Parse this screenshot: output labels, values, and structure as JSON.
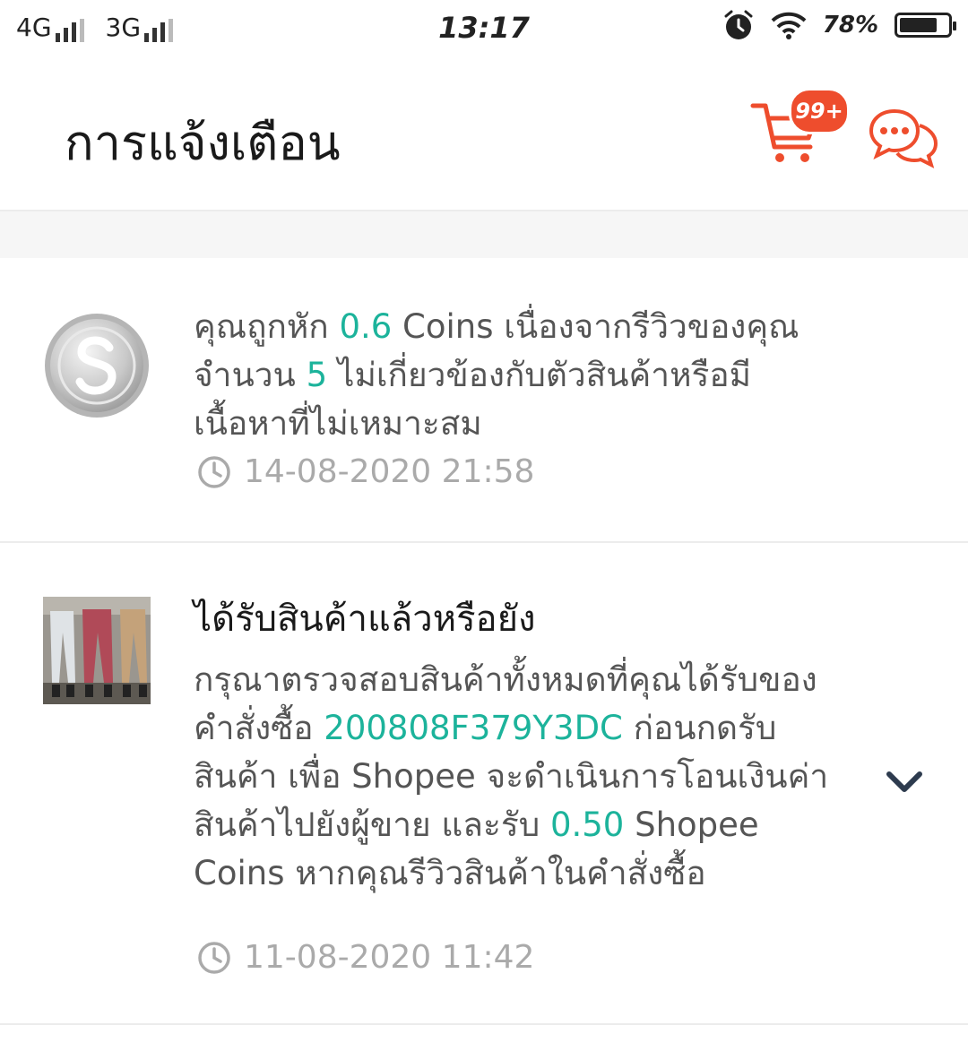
{
  "status_bar": {
    "network1": "4G",
    "network2": "3G",
    "time": "13:17",
    "battery_percent": "78%",
    "battery_level": 0.78
  },
  "header": {
    "title": "การแจ้งเตือน",
    "cart_badge": "99+"
  },
  "colors": {
    "accent": "#ee4d2d",
    "highlight": "#1cb39b",
    "muted": "#aaaaaa"
  },
  "notifications": [
    {
      "icon": "shopee-coin-icon",
      "message_parts": [
        {
          "text": "คุณถูกหัก ",
          "hl": false
        },
        {
          "text": "0.6",
          "hl": true
        },
        {
          "text": " Coins เนื่องจากรีวิวของคุณจำนวน ",
          "hl": false
        },
        {
          "text": "5",
          "hl": true
        },
        {
          "text": " ไม่เกี่ยวข้องกับตัวสินค้าหรือมีเนื้อหาที่ไม่เหมาะสม",
          "hl": false
        }
      ],
      "timestamp": "14-08-2020 21:58"
    },
    {
      "icon": "product-thumbnail",
      "heading": "ได้รับสินค้าแล้วหรือยัง",
      "message_parts": [
        {
          "text": "กรุณาตรวจสอบสินค้าทั้งหมดที่คุณได้รับของคำสั่งซื้อ ",
          "hl": false
        },
        {
          "text": "200808F379Y3DC",
          "hl": true
        },
        {
          "text": " ก่อนกดรับสินค้า เพื่อ Shopee จะดำเนินการโอนเงินค่าสินค้าไปยังผู้ขาย และรับ ",
          "hl": false
        },
        {
          "text": "0.50",
          "hl": true
        },
        {
          "text": " Shopee Coins หากคุณรีวิวสินค้าในคำสั่งซื้อ",
          "hl": false
        }
      ],
      "timestamp": "11-08-2020 11:42"
    }
  ]
}
